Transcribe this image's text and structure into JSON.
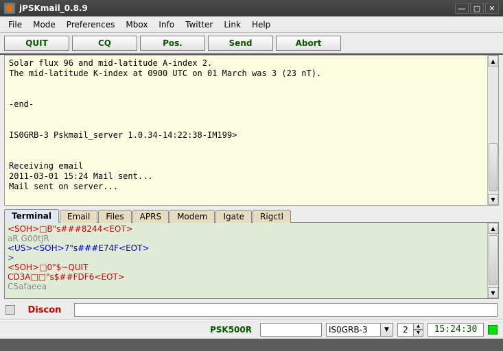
{
  "window": {
    "title": "jPSKmail_0.8.9"
  },
  "menu": [
    "File",
    "Mode",
    "Preferences",
    "Mbox",
    "Info",
    "Twitter",
    "Link",
    "Help"
  ],
  "toolbar": {
    "quit": "QUIT",
    "cq": "CQ",
    "pos": "Pos.",
    "send": "Send",
    "abort": "Abort"
  },
  "log": "Solar flux 96 and mid-latitude A-index 2.\nThe mid-latitude K-index at 0900 UTC on 01 March was 3 (23 nT).\n\n\n-end-\n\n\nIS0GRB-3 Pskmail_server 1.0.34-14:22:38-IM199>\n\n\nReceiving email\n2011-03-01 15:24 Mail sent...\nMail sent on server...",
  "tabs": [
    "Terminal",
    "Email",
    "Files",
    "APRS",
    "Modem",
    "Igate",
    "Rigctl"
  ],
  "active_tab": 0,
  "terminal_lines": [
    {
      "cls": "tl-red",
      "t": "<SOH>□B\"s###8244<EOT>"
    },
    {
      "cls": "tl-gray",
      "t": "aR G00tJR"
    },
    {
      "cls": "tl-blue",
      "t": "<US><SOH>7\"s###E74F<EOT>"
    },
    {
      "cls": "tl-dblue",
      "t": ">"
    },
    {
      "cls": "tl-red",
      "t": "<SOH>□0\"$~QUIT"
    },
    {
      "cls": "tl-red",
      "t": "CD3A□□\"s$##FDF6<EOT>"
    },
    {
      "cls": "tl-gray",
      "t": "C5afaeea"
    }
  ],
  "status": {
    "connection": "Discon",
    "input": ""
  },
  "bottom": {
    "mode": "PSK500R",
    "freq": "",
    "call": "IS0GRB-3",
    "spin": "2",
    "time": "15:24:30"
  }
}
